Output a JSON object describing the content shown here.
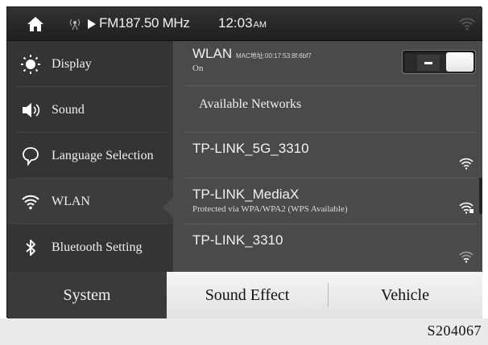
{
  "status_bar": {
    "frequency": "FM187.50 MHz",
    "time": "12:03",
    "time_suffix": "AM"
  },
  "sidebar": {
    "items": [
      {
        "label": "Display",
        "icon": "sun-icon"
      },
      {
        "label": "Sound",
        "icon": "speaker-icon"
      },
      {
        "label": "Language Selection",
        "icon": "speech-bubble-icon"
      },
      {
        "label": "WLAN",
        "icon": "wifi-icon"
      },
      {
        "label": "Bluetooth Setting",
        "icon": "bluetooth-icon"
      }
    ],
    "active": "WLAN"
  },
  "wlan": {
    "title": "WLAN",
    "mac": "MAC地址:00:17:53:8f:6bf7",
    "state": "On",
    "toggle_on": true
  },
  "networks": {
    "header": "Available Networks",
    "items": [
      {
        "name": "TP-LINK_5G_3310",
        "sub": ""
      },
      {
        "name": "TP-LINK_MediaX",
        "sub": "Protected via WPA/WPA2 (WPS Available)"
      },
      {
        "name": "TP-LINK_3310",
        "sub": ""
      }
    ]
  },
  "tabs": [
    {
      "label": "System",
      "active": true
    },
    {
      "label": "Sound Effect",
      "active": false
    },
    {
      "label": "Vehicle",
      "active": false
    }
  ],
  "footer": {
    "code": "S204067"
  },
  "colors": {
    "sidebar_bg": "#343434",
    "panel_bg": "#4a4a4a",
    "text": "#f2f2f2"
  }
}
